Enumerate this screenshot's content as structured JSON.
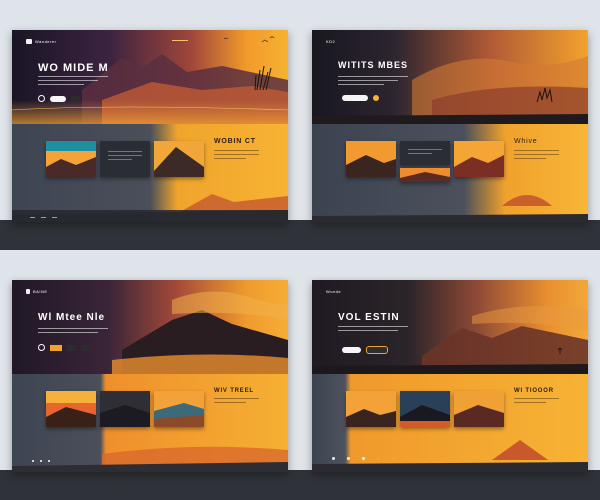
{
  "panels": [
    {
      "id": "top-left",
      "logo_text": "Wanderer",
      "hero_title": "WO MIDE M",
      "section_title": "WOBIN CT",
      "primary_button": "",
      "secondary_button": ""
    },
    {
      "id": "top-right",
      "logo_text": "KD2",
      "hero_title": "WITITS MBES",
      "section_title": "Whive",
      "primary_button": "",
      "secondary_button": ""
    },
    {
      "id": "bottom-left",
      "logo_text": "BAINE",
      "hero_title": "Wl Mtee Nle",
      "section_title": "WIV TREEL",
      "primary_button": "",
      "secondary_button": ""
    },
    {
      "id": "bottom-right",
      "logo_text": "Wonde",
      "hero_title": "VOL ESTIN",
      "section_title": "WI TIOOOR",
      "primary_button": "",
      "secondary_button": ""
    }
  ],
  "colors": {
    "accent": "#f0a42c",
    "hero_dark": "#1a1526",
    "hero_warm": "#f6b232",
    "section_gray": "#4a4f5a",
    "page_bg": "#dfe4ea",
    "footer_bg": "#2f3238"
  },
  "icons": [
    "logo-mark-icon",
    "play-circle-icon",
    "bird-icon",
    "mountain-icon",
    "sun-icon"
  ]
}
